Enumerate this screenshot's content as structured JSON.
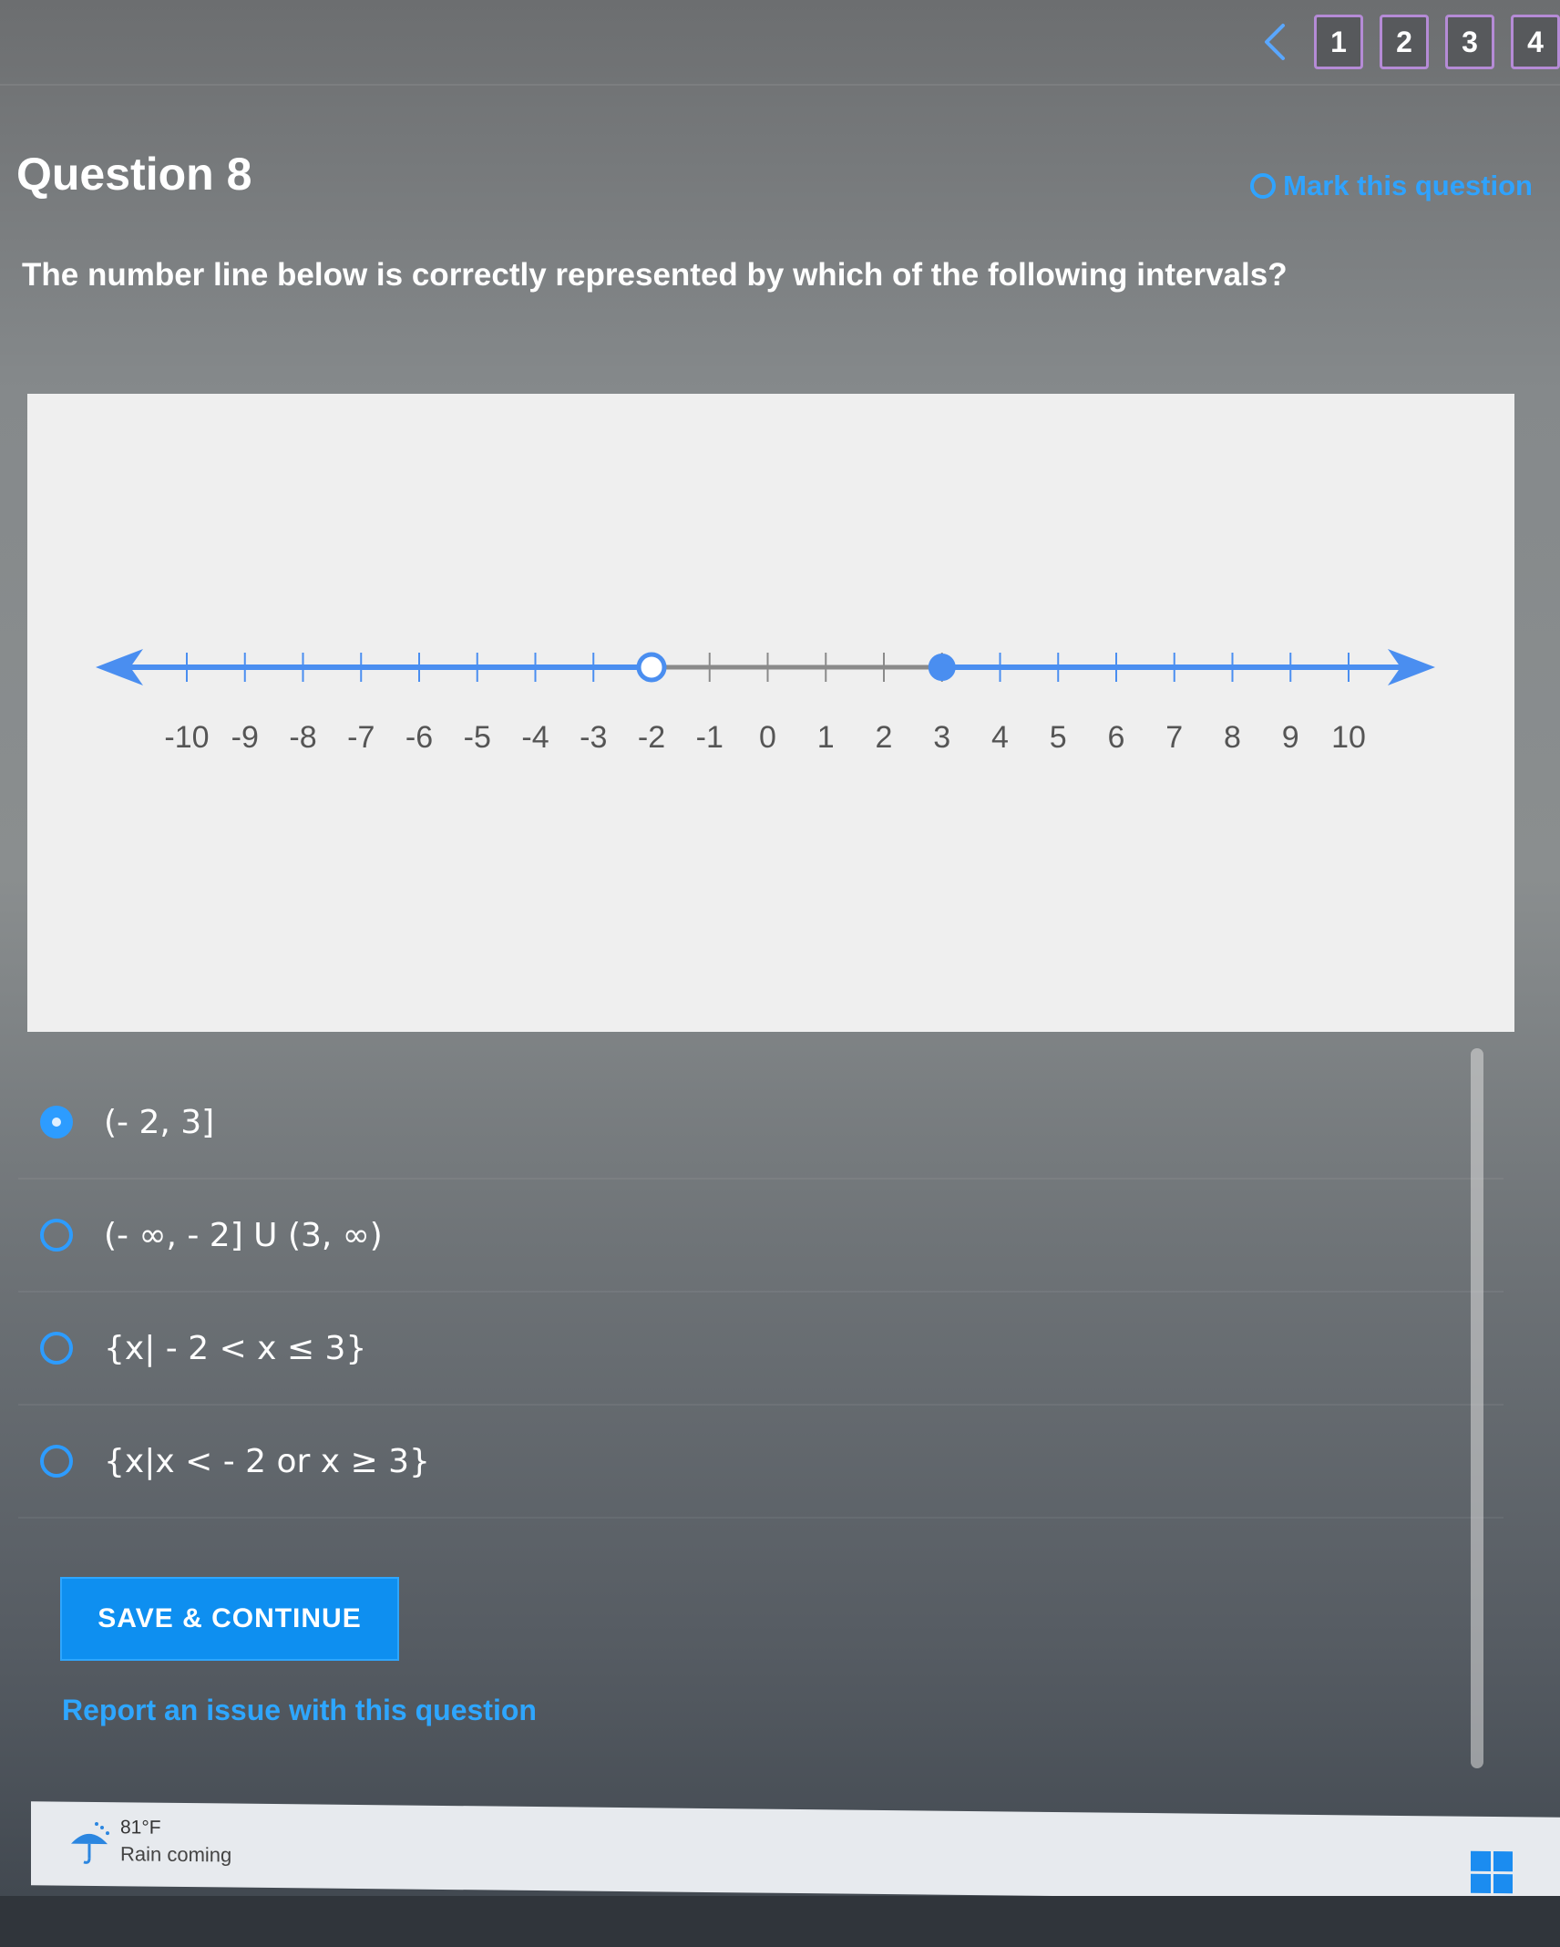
{
  "pagination": {
    "prev_icon": "chevron-left-icon",
    "pages": [
      "1",
      "2",
      "3",
      "4"
    ]
  },
  "question": {
    "title": "Question 8",
    "mark_label": "Mark this question",
    "prompt": "The number line below is correctly represented by which of the following intervals?"
  },
  "number_line": {
    "min": -10,
    "max": 10,
    "tick_labels": [
      "-10",
      "-9",
      "-8",
      "-7",
      "-6",
      "-5",
      "-4",
      "-3",
      "-2",
      "-1",
      "0",
      "1",
      "2",
      "3",
      "4",
      "5",
      "6",
      "7",
      "8",
      "9",
      "10"
    ],
    "open_point": -2,
    "closed_point": 3,
    "shaded": "left of -2 and right of 3",
    "line_color": "#4a8ef0",
    "gap_color": "#8a8a8a"
  },
  "options": [
    {
      "label": "(- 2, 3]",
      "selected": true
    },
    {
      "label": "(- ∞, - 2] U (3, ∞)",
      "selected": false
    },
    {
      "label": "{x| - 2 < x ≤ 3}",
      "selected": false
    },
    {
      "label": "{x|x < - 2 or x ≥ 3}",
      "selected": false
    }
  ],
  "actions": {
    "save_label": "SAVE & CONTINUE",
    "report_label": "Report an issue with this question"
  },
  "taskbar": {
    "temperature": "81°F",
    "weather": "Rain coming",
    "weather_icon": "umbrella-rain-icon",
    "start_icon": "windows-start-icon"
  },
  "colors": {
    "accent": "#2d9cff",
    "button": "#0e8ff0",
    "page_border": "#b58bd6"
  }
}
